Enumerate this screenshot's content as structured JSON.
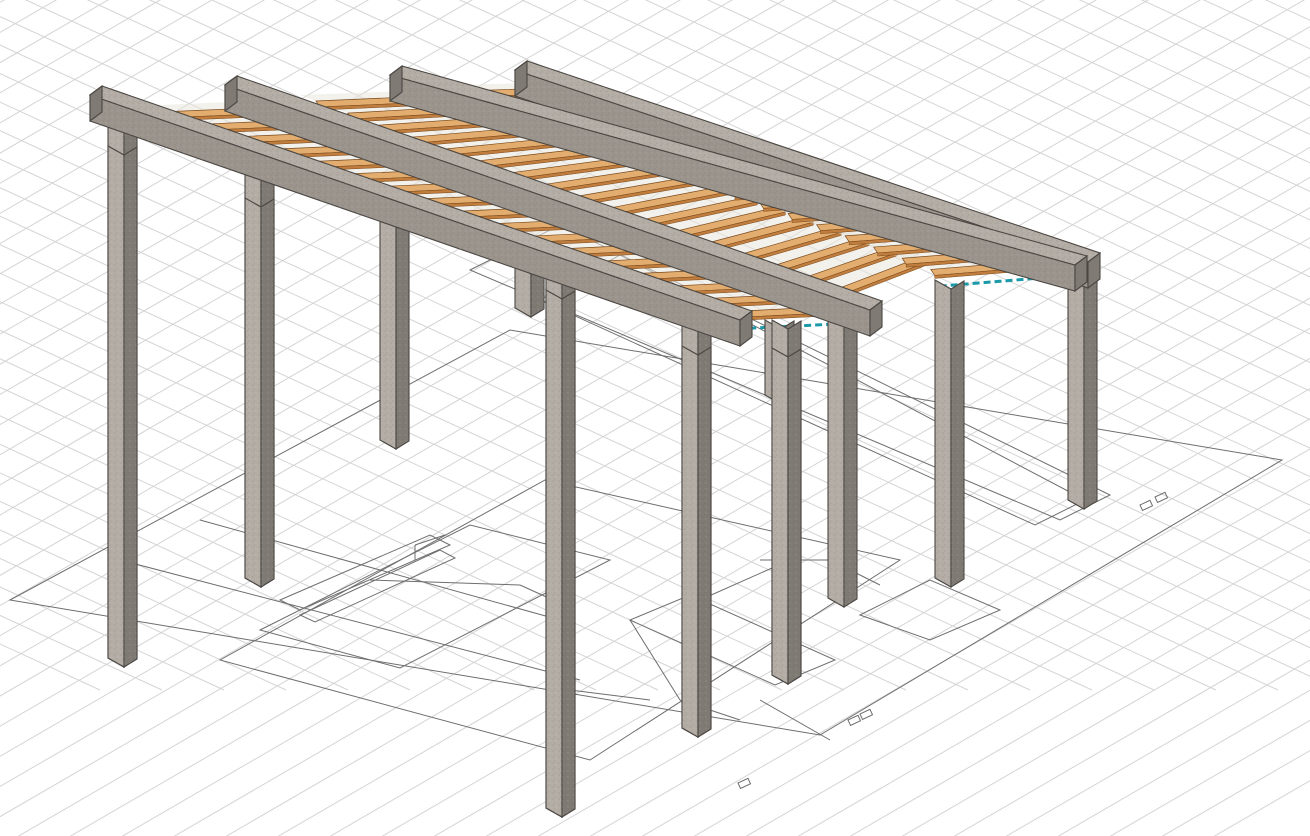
{
  "viewport": {
    "name": "3d-isometric-view",
    "projection": "isometric",
    "model": "pergola-frame",
    "grid": true
  },
  "colors": {
    "background": "#ffffff",
    "grid_line": "#d4d4d4",
    "plan_line": "#6e6e6e",
    "concrete_light": "#b4ada5",
    "concrete_mid": "#9a948d",
    "concrete_dark": "#7f7a74",
    "concrete_edge": "#4a4642",
    "wood_top": "#e2ad6e",
    "wood_side": "#c07d3d",
    "wood_edge": "#7a4a1e",
    "roof_glass": "#e9e5dd",
    "selection": "#1a9aa8"
  },
  "model": {
    "main_beams": 4,
    "rafters_per_bay": 17,
    "columns_visible": 10,
    "selected_edges": 2
  }
}
